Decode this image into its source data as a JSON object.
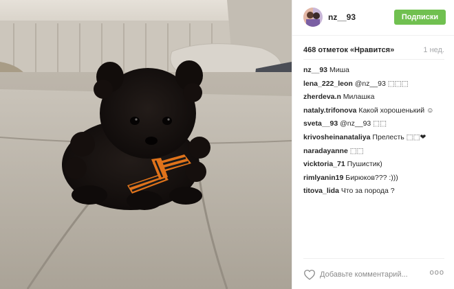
{
  "post": {
    "username": "nz__93",
    "follow_label": "Подписки",
    "likes_text": "468 отметок «Нравится»",
    "time_ago": "1 нед.",
    "comments": [
      {
        "user": "nz__93",
        "text": "Миша"
      },
      {
        "user": "lena_222_leon",
        "text": "@nz__93 ⬚⬚⬚"
      },
      {
        "user": "zherdeva.n",
        "text": "Милашка"
      },
      {
        "user": "nataly.trifonova",
        "text": "Какой хорошенький ☺"
      },
      {
        "user": "sveta__93",
        "text": "@nz__93 ⬚⬚"
      },
      {
        "user": "krivosheinanataliya",
        "text": "Прелесть ⬚⬚❤"
      },
      {
        "user": "naradayanne",
        "text": "⬚⬚"
      },
      {
        "user": "vicktoria_71",
        "text": "Пушистик)"
      },
      {
        "user": "rimlyanin19",
        "text": "Бирюков??? :)))"
      },
      {
        "user": "titova_lida",
        "text": "Что за порода ?"
      }
    ],
    "comment_placeholder": "Добавьте комментарий...",
    "more_label": "ooo"
  },
  "colors": {
    "follow_button": "#70c050",
    "muted_text": "#a5a7aa",
    "divider": "#efefef"
  },
  "icons": {
    "like": "heart-outline-icon",
    "more": "more-options-icon"
  }
}
